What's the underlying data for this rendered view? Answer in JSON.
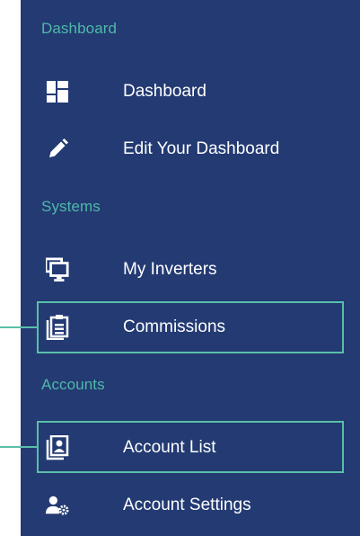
{
  "sections": [
    {
      "title": "Dashboard",
      "items": [
        {
          "label": "Dashboard",
          "icon": "dashboard-grid-icon"
        },
        {
          "label": "Edit Your Dashboard",
          "icon": "pencil-icon"
        }
      ]
    },
    {
      "title": "Systems",
      "items": [
        {
          "label": "My Inverters",
          "icon": "monitor-icon"
        },
        {
          "label": "Commissions",
          "icon": "clipboard-icon",
          "highlighted": true
        }
      ]
    },
    {
      "title": "Accounts",
      "items": [
        {
          "label": "Account List",
          "icon": "contact-card-icon",
          "highlighted": true
        },
        {
          "label": "Account Settings",
          "icon": "user-settings-icon"
        }
      ]
    }
  ],
  "colors": {
    "sidebar_bg": "#233a73",
    "section_title": "#4fb9a8",
    "highlight": "#5bbfa8",
    "label": "#ffffff"
  }
}
